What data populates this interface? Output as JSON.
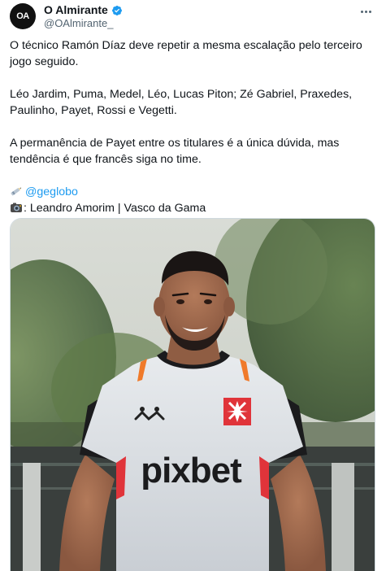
{
  "author": {
    "display_name": "O Almirante",
    "handle": "@OAlmirante_",
    "avatar_text": "OA",
    "verified": true
  },
  "tweet": {
    "paragraph1": "O técnico Ramón Díaz deve repetir a mesma escalação pelo terceiro jogo seguido.",
    "paragraph2": "Léo Jardim, Puma, Medel, Léo, Lucas Piton; Zé Gabriel, Praxedes, Paulinho, Payet, Rossi e Vegetti.",
    "paragraph3": "A permanência de Payet entre os titulares é a única dúvida, mas tendência é que francês siga no time.",
    "source_link": "@geglobo",
    "photo_credit": ": Leandro Amorim | Vasco da Gama"
  },
  "photo": {
    "jersey_sponsor": "pixbet",
    "jersey_brand": "Kappa"
  },
  "colors": {
    "link": "#1d9bf0",
    "verified": "#1d9bf0",
    "text": "#0f1419",
    "muted": "#536471"
  },
  "icons": {
    "verified": "verified-badge-icon",
    "more": "more-horizontal-icon",
    "pen": "pen-emoji-icon",
    "camera": "camera-emoji-icon"
  }
}
